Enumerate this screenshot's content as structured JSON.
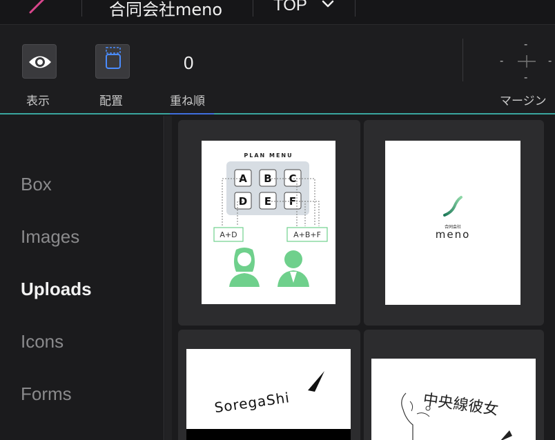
{
  "header": {
    "site_name": "合同会社meno",
    "page_select": "TOP"
  },
  "toolbar": {
    "display_label": "表示",
    "placement_label": "配置",
    "zorder_label": "重ね順",
    "zorder_value": "0",
    "margin_label": "マージン",
    "margin_dash": "-"
  },
  "sidebar": {
    "items": [
      {
        "label": "Box",
        "active": false
      },
      {
        "label": "Images",
        "active": false
      },
      {
        "label": "Uploads",
        "active": true
      },
      {
        "label": "Icons",
        "active": false
      },
      {
        "label": "Forms",
        "active": false
      }
    ]
  },
  "uploads": {
    "plan_menu": {
      "title": "PLAN MENU",
      "keys": [
        "A",
        "B",
        "C",
        "D",
        "E",
        "F"
      ],
      "left_tag": "A+D",
      "right_tag": "A+B+F"
    },
    "meno_logo": {
      "company": "合同会社",
      "name": "meno"
    },
    "soregashi_logo": {
      "text": "SoregaShi"
    },
    "handwritten": {
      "text": "中央線彼女"
    }
  },
  "colors": {
    "accent_pink": "#d9468c",
    "accent_teal": "#3aa7a0",
    "accent_blue": "#3f6fe0",
    "plan_green": "#6fd08c",
    "meno_green": "#1f7a5a"
  }
}
